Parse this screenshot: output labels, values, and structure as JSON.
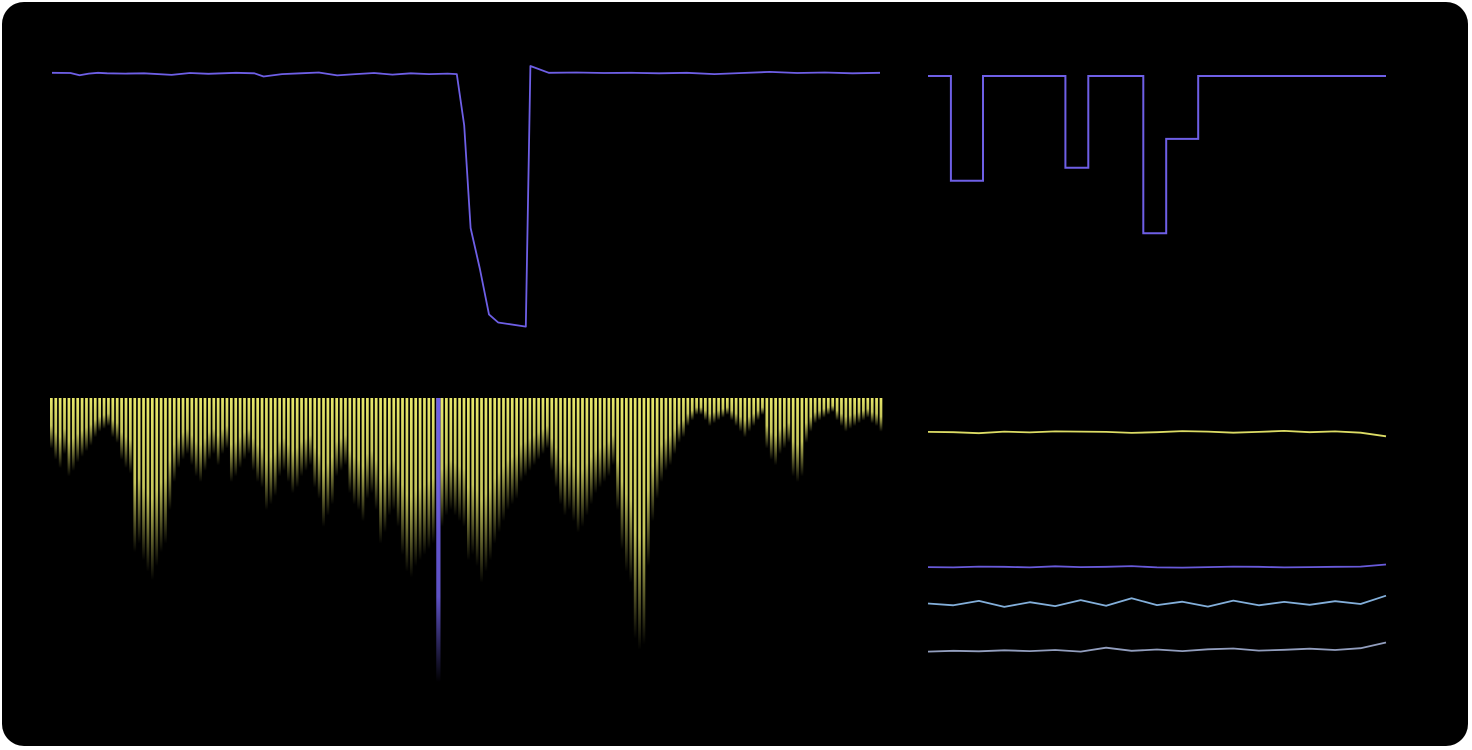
{
  "colors": {
    "background": "#000000",
    "frame": "#ffffff",
    "grid": "#8a8a8a",
    "purple": "#6e5fe6",
    "yellow": "#e8e86a",
    "light_blue": "#8ab8e6",
    "slate": "#9aa6c8"
  },
  "chart_data": [
    {
      "type": "line",
      "x": [
        0,
        2,
        3,
        4,
        5,
        6,
        8,
        10,
        13,
        15,
        17,
        20,
        22,
        23,
        25,
        27,
        29,
        31,
        33,
        35,
        37,
        39,
        41,
        43,
        44,
        44.8,
        45.5,
        46.5,
        47.5,
        48.5,
        51.5,
        52,
        54,
        57,
        60,
        63,
        66,
        69,
        72,
        75,
        78,
        81,
        84,
        87,
        90
      ],
      "values": [
        97.5,
        97.4,
        96.6,
        97.2,
        97.5,
        97.3,
        97.2,
        97.3,
        96.7,
        97.4,
        97.1,
        97.5,
        97.3,
        96.1,
        97.0,
        97.3,
        97.6,
        96.5,
        97.0,
        97.4,
        96.8,
        97.3,
        97.0,
        97.2,
        97.0,
        78,
        40,
        25,
        8,
        5,
        3.5,
        100,
        97.5,
        97.6,
        97.4,
        97.5,
        97.3,
        97.5,
        97.0,
        97.4,
        97.8,
        97.4,
        97.6,
        97.3,
        97.5
      ],
      "xlim": [
        0,
        90
      ],
      "ylim": [
        0,
        100
      ],
      "grid_cols": 9,
      "grid_rows": 7,
      "grid": true,
      "series_color": "purple"
    },
    {
      "type": "line",
      "step": true,
      "x": [
        0,
        2.5,
        2.5,
        6,
        6,
        15,
        15,
        17.5,
        17.5,
        23.5,
        23.5,
        26,
        26,
        29.5,
        29.5,
        50
      ],
      "values": [
        100,
        100,
        60,
        60,
        100,
        100,
        65,
        65,
        100,
        100,
        40,
        40,
        76,
        76,
        100,
        100
      ],
      "xlim": [
        0,
        50
      ],
      "ylim": [
        0,
        100
      ],
      "grid_cols": 9,
      "grid_rows": 9,
      "grid": true,
      "series_color": "purple"
    },
    {
      "type": "bar",
      "values": [
        18,
        22,
        25,
        20,
        28,
        26,
        23,
        21,
        19,
        17,
        14,
        12,
        11,
        10,
        14,
        16,
        22,
        25,
        27,
        55,
        52,
        58,
        62,
        65,
        60,
        55,
        52,
        40,
        30,
        25,
        22,
        20,
        24,
        28,
        30,
        26,
        22,
        20,
        24,
        20,
        18,
        30,
        28,
        25,
        22,
        20,
        26,
        30,
        32,
        40,
        38,
        35,
        28,
        26,
        30,
        34,
        32,
        28,
        26,
        24,
        32,
        36,
        46,
        42,
        38,
        28,
        26,
        24,
        34,
        38,
        40,
        44,
        36,
        34,
        40,
        52,
        48,
        42,
        40,
        46,
        56,
        62,
        64,
        60,
        58,
        56,
        54,
        52,
        48,
        46,
        42,
        40,
        42,
        44,
        46,
        58,
        56,
        60,
        66,
        62,
        58,
        52,
        48,
        44,
        40,
        38,
        36,
        30,
        28,
        26,
        24,
        22,
        20,
        18,
        26,
        32,
        38,
        42,
        40,
        44,
        48,
        46,
        42,
        38,
        34,
        32,
        30,
        28,
        24,
        40,
        54,
        62,
        66,
        86,
        90,
        88,
        60,
        44,
        36,
        30,
        26,
        24,
        20,
        16,
        14,
        10,
        8,
        6,
        6,
        8,
        10,
        9,
        8,
        7,
        6,
        8,
        10,
        12,
        14,
        12,
        10,
        8,
        6,
        18,
        22,
        24,
        20,
        18,
        16,
        28,
        30,
        28,
        16,
        12,
        9,
        8,
        7,
        6,
        5,
        8,
        10,
        12,
        11,
        10,
        9,
        8,
        7,
        9,
        10,
        12
      ],
      "highlight_index": 88,
      "highlight_value": 100,
      "ylim": [
        0,
        100
      ],
      "grid_cols": 9,
      "grid_rows": 7,
      "grid": true,
      "series_color": "yellow",
      "highlight_color": "purple"
    },
    {
      "type": "line",
      "x": [
        0,
        1,
        2,
        3,
        4,
        5,
        6,
        7,
        8,
        9,
        10,
        11,
        12,
        13,
        14,
        15,
        16,
        17,
        18
      ],
      "series": [
        {
          "values": [
            88.5,
            88.4,
            88,
            88.6,
            88.3,
            88.7,
            88.6,
            88.5,
            88.1,
            88.4,
            88.8,
            88.6,
            88.2,
            88.5,
            88.9,
            88.4,
            88.7,
            88.2,
            86.8
          ],
          "color": "yellow"
        },
        {
          "values": [
            36.5,
            36.4,
            36.7,
            36.6,
            36.4,
            36.8,
            36.5,
            36.6,
            36.9,
            36.4,
            36.3,
            36.5,
            36.7,
            36.6,
            36.4,
            36.5,
            36.6,
            36.7,
            37.5
          ],
          "color": "purple"
        },
        {
          "values": [
            22.5,
            21.8,
            23.5,
            21.2,
            23.0,
            21.5,
            23.8,
            21.6,
            24.5,
            21.9,
            23.2,
            21.3,
            23.6,
            21.8,
            23.1,
            22.0,
            23.4,
            22.3,
            25.5
          ],
          "color": "light_blue"
        },
        {
          "values": [
            4,
            4.3,
            4.1,
            4.5,
            4.2,
            4.6,
            4.0,
            5.5,
            4.3,
            4.8,
            4.2,
            4.9,
            5.2,
            4.4,
            4.7,
            5.1,
            4.6,
            5.3,
            7.5
          ],
          "color": "slate"
        }
      ],
      "xlim": [
        0,
        18
      ],
      "ylim": [
        0,
        100
      ],
      "grid_cols": 9,
      "grid_rows": 9,
      "grid": true
    }
  ]
}
